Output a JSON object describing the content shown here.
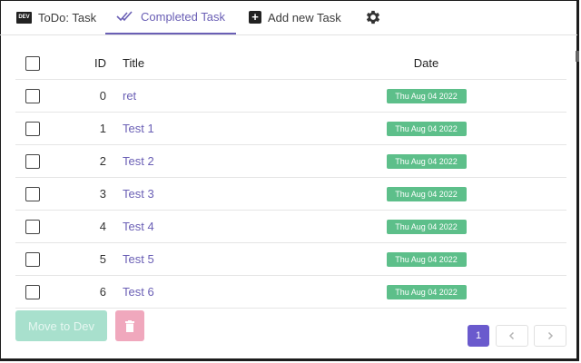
{
  "tabs": [
    {
      "icon": "dev-badge-icon",
      "label": "ToDo: Task",
      "badge": "DEV"
    },
    {
      "icon": "double-check-icon",
      "label": "Completed Task"
    },
    {
      "icon": "plus-square-icon",
      "label": "Add new Task"
    },
    {
      "icon": "gear-icon",
      "label": ""
    }
  ],
  "table": {
    "headers": {
      "id": "ID",
      "title": "Title",
      "date": "Date"
    },
    "rows": [
      {
        "id": "0",
        "title": "ret",
        "date": "Thu Aug 04 2022"
      },
      {
        "id": "1",
        "title": "Test 1",
        "date": "Thu Aug 04 2022"
      },
      {
        "id": "2",
        "title": "Test 2",
        "date": "Thu Aug 04 2022"
      },
      {
        "id": "3",
        "title": "Test 3",
        "date": "Thu Aug 04 2022"
      },
      {
        "id": "4",
        "title": "Test 4",
        "date": "Thu Aug 04 2022"
      },
      {
        "id": "5",
        "title": "Test 5",
        "date": "Thu Aug 04 2022"
      },
      {
        "id": "6",
        "title": "Test 6",
        "date": "Thu Aug 04 2022"
      }
    ]
  },
  "actions": {
    "move_label": "Move to Dev",
    "delete_icon": "trash-icon"
  },
  "pagination": {
    "current": "1",
    "prev_icon": "chevron-left-icon",
    "next_icon": "chevron-right-icon"
  },
  "colors": {
    "accent": "#6a5fb5",
    "date_badge": "#5dbf8a",
    "move_button": "#a8e0cd",
    "delete_button": "#f0a8bd",
    "active_page": "#6a5acd"
  }
}
